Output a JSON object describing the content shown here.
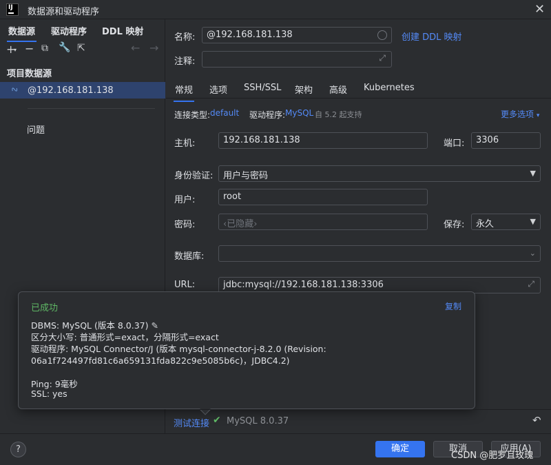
{
  "window": {
    "title": "数据源和驱动程序",
    "logo_text": "IJ"
  },
  "sidebar": {
    "tabs": [
      "数据源",
      "驱动程序",
      "DDL 映射"
    ],
    "group_title": "项目数据源",
    "datasource": "@192.168.181.138",
    "problems": "问题"
  },
  "form": {
    "name_label": "名称:",
    "name_value": "@192.168.181.138",
    "ddl_link": "创建 DDL 映射",
    "comment_label": "注释:",
    "tabs": [
      "常规",
      "选项",
      "SSH/SSL",
      "架构",
      "高级",
      "Kubernetes"
    ],
    "conn_type_label": "连接类型:",
    "conn_type_value": "default",
    "driver_label": "驱动程序:",
    "driver_value": "MySQL",
    "driver_note": "自 5.2 起支持",
    "more_options": "更多选项",
    "host_label": "主机:",
    "host_value": "192.168.181.138",
    "port_label": "端口:",
    "port_value": "3306",
    "auth_label": "身份验证:",
    "auth_value": "用户与密码",
    "user_label": "用户:",
    "user_value": "root",
    "password_label": "密码:",
    "password_placeholder": "‹已隐藏›",
    "save_label": "保存:",
    "save_value": "永久",
    "database_label": "数据库:",
    "url_label": "URL:",
    "url_value": "jdbc:mysql://192.168.181.138:3306"
  },
  "popup": {
    "status": "已成功",
    "copy": "复制",
    "lines": [
      "DBMS: MySQL (版本 8.0.37)",
      "区分大小写: 普通形式=exact，分隔形式=exact",
      "驱动程序: MySQL Connector/J (版本 mysql-connector-j-8.2.0 (Revision:",
      "06a1f724497fd81c6a659131fda822c9e5085b6c)，JDBC4.2)",
      "Ping: 9毫秒",
      "SSL: yes"
    ]
  },
  "test": {
    "link": "测试连接",
    "result": "MySQL 8.0.37"
  },
  "footer": {
    "help": "?",
    "ok": "确定",
    "cancel": "取消",
    "apply": "应用(A)",
    "watermark": "CSDN @肥罗且玫瑰"
  },
  "colors": {
    "accent": "#3574f0",
    "link": "#548af7",
    "success": "#5fb865",
    "selection": "#2e436e"
  }
}
